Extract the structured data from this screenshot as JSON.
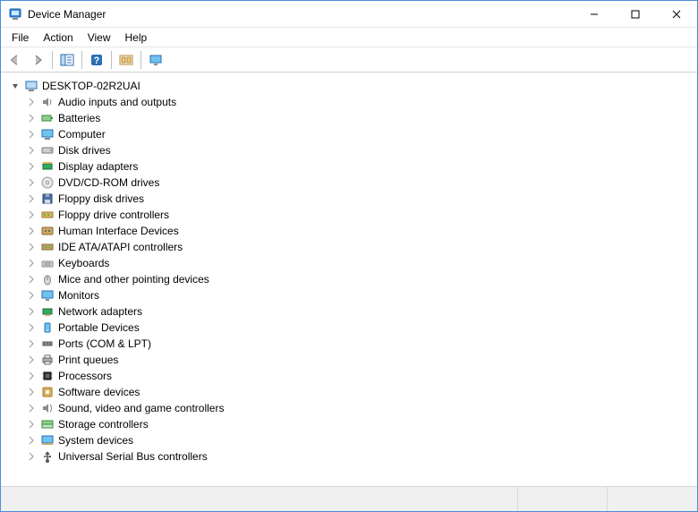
{
  "window": {
    "title": "Device Manager"
  },
  "menubar": {
    "items": [
      "File",
      "Action",
      "View",
      "Help"
    ]
  },
  "toolbar": {
    "buttons": [
      "back",
      "forward",
      "sep",
      "show-hide-console-tree",
      "sep",
      "help",
      "sep",
      "scan-for-hardware-changes",
      "sep",
      "device-manager-view"
    ]
  },
  "tree": {
    "root": {
      "label": "DESKTOP-02R2UAI",
      "expanded": true,
      "icon": "computer"
    },
    "categories": [
      {
        "label": "Audio inputs and outputs",
        "icon": "audio"
      },
      {
        "label": "Batteries",
        "icon": "battery"
      },
      {
        "label": "Computer",
        "icon": "computer"
      },
      {
        "label": "Disk drives",
        "icon": "disk"
      },
      {
        "label": "Display adapters",
        "icon": "display"
      },
      {
        "label": "DVD/CD-ROM drives",
        "icon": "dvd"
      },
      {
        "label": "Floppy disk drives",
        "icon": "floppy"
      },
      {
        "label": "Floppy drive controllers",
        "icon": "controller"
      },
      {
        "label": "Human Interface Devices",
        "icon": "hid"
      },
      {
        "label": "IDE ATA/ATAPI controllers",
        "icon": "ide"
      },
      {
        "label": "Keyboards",
        "icon": "keyboard"
      },
      {
        "label": "Mice and other pointing devices",
        "icon": "mouse"
      },
      {
        "label": "Monitors",
        "icon": "monitor"
      },
      {
        "label": "Network adapters",
        "icon": "network"
      },
      {
        "label": "Portable Devices",
        "icon": "portable"
      },
      {
        "label": "Ports (COM & LPT)",
        "icon": "port"
      },
      {
        "label": "Print queues",
        "icon": "printer"
      },
      {
        "label": "Processors",
        "icon": "cpu"
      },
      {
        "label": "Software devices",
        "icon": "software"
      },
      {
        "label": "Sound, video and game controllers",
        "icon": "sound"
      },
      {
        "label": "Storage controllers",
        "icon": "storage"
      },
      {
        "label": "System devices",
        "icon": "system"
      },
      {
        "label": "Universal Serial Bus controllers",
        "icon": "usb"
      }
    ]
  },
  "statusbar": {
    "text": ""
  }
}
